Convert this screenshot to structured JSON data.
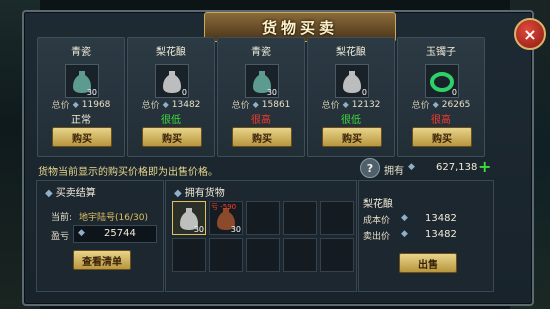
{
  "title": "货物买卖",
  "close_icon": "×",
  "goods": [
    {
      "name": "青瓷",
      "qty": "30",
      "price_label": "总价",
      "price": "11968",
      "status": "正常",
      "status_color": "#f2ecd8",
      "buy_label": "购买",
      "icon": "celadon-vase-icon",
      "icon_color": "#6ab0a0"
    },
    {
      "name": "梨花酿",
      "qty": "0",
      "price_label": "总价",
      "price": "13482",
      "status": "很低",
      "status_color": "#3ddc3d",
      "buy_label": "购买",
      "icon": "wine-jug-icon",
      "icon_color": "#d8d8d8"
    },
    {
      "name": "青瓷",
      "qty": "30",
      "price_label": "总价",
      "price": "15861",
      "status": "很高",
      "status_color": "#ff3a2a",
      "buy_label": "购买",
      "icon": "celadon-vase-icon",
      "icon_color": "#6ab0a0"
    },
    {
      "name": "梨花酿",
      "qty": "0",
      "price_label": "总价",
      "price": "12132",
      "status": "很低",
      "status_color": "#3ddc3d",
      "buy_label": "购买",
      "icon": "wine-jug-icon",
      "icon_color": "#d8d8d8"
    },
    {
      "name": "玉镯子",
      "qty": "0",
      "price_label": "总价",
      "price": "26265",
      "status": "很高",
      "status_color": "#ff3a2a",
      "buy_label": "购买",
      "icon": "jade-bracelet-icon",
      "icon_color": "#2ed06a"
    }
  ],
  "info_text": "货物当前显示的购买价格即为出售价格。",
  "owned_label": "拥有",
  "owned_value": "627,138",
  "help_icon": "?",
  "plus_icon": "+",
  "settlement": {
    "head": "买卖结算",
    "current_label": "当前:",
    "current_value": "地宇陆号(16/30)",
    "profit_label": "盈亏",
    "profit_value": "25744",
    "list_button": "查看清单"
  },
  "inventory": {
    "head": "拥有货物",
    "items": [
      {
        "qty": "30",
        "icon": "wine-jug-icon",
        "selected": true
      },
      {
        "qty": "30",
        "icon": "clay-jar-icon",
        "selected": false,
        "tag": "亏 -590"
      }
    ]
  },
  "detail": {
    "name": "梨花酿",
    "cost_label": "成本价",
    "cost_value": "13482",
    "sell_label": "卖出价",
    "sell_value": "13482",
    "sell_button": "出售"
  }
}
